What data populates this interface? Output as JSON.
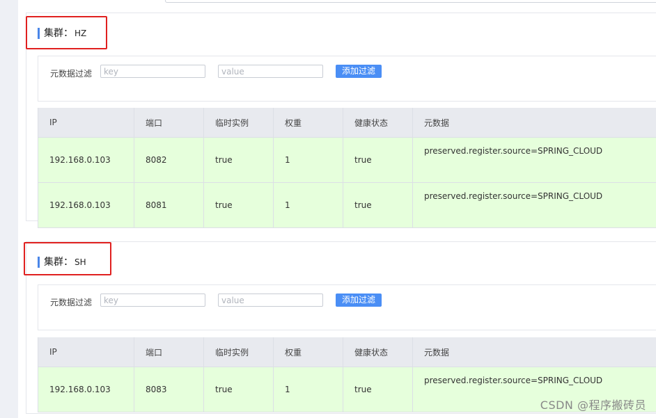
{
  "filter": {
    "label": "元数据过滤",
    "key_placeholder": "key",
    "value_placeholder": "value",
    "button_label": "添加过滤"
  },
  "table_headers": [
    "IP",
    "端口",
    "临时实例",
    "权重",
    "健康状态",
    "元数据"
  ],
  "clusters": [
    {
      "title_prefix": "集群：",
      "name": "HZ",
      "rows": [
        {
          "ip": "192.168.0.103",
          "port": "8082",
          "ephemeral": "true",
          "weight": "1",
          "healthy": "true",
          "metadata": "preserved.register.source=SPRING_CLOUD"
        },
        {
          "ip": "192.168.0.103",
          "port": "8081",
          "ephemeral": "true",
          "weight": "1",
          "healthy": "true",
          "metadata": "preserved.register.source=SPRING_CLOUD"
        }
      ]
    },
    {
      "title_prefix": "集群：",
      "name": "SH",
      "rows": [
        {
          "ip": "192.168.0.103",
          "port": "8083",
          "ephemeral": "true",
          "weight": "1",
          "healthy": "true",
          "metadata": "preserved.register.source=SPRING_CLOUD"
        }
      ]
    }
  ],
  "watermark": "CSDN @程序搬砖员",
  "colors": {
    "accent": "#4a86e8",
    "button": "#4a8ef5",
    "row_background": "#e6ffdc",
    "highlight_box": "#e0201f"
  }
}
